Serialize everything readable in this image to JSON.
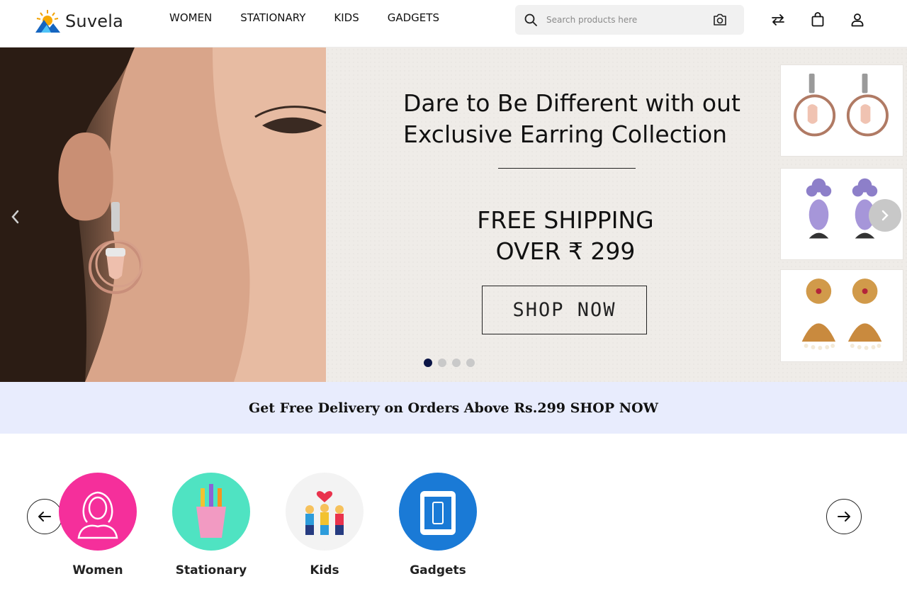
{
  "brand": {
    "name": "Suvela"
  },
  "nav": {
    "items": [
      "WOMEN",
      "STATIONARY",
      "KIDS",
      "GADGETS"
    ]
  },
  "search": {
    "placeholder": "Search products here"
  },
  "icons": {
    "search": "search-icon",
    "camera": "camera-icon",
    "compare": "compare-arrows-icon",
    "cart": "shopping-bag-icon",
    "account": "user-icon"
  },
  "hero": {
    "title_line1": "Dare to Be Different with out",
    "title_line2": "Exclusive Earring Collection",
    "shipping_line1": "FREE SHIPPING",
    "shipping_line2": "OVER ₹ 299",
    "cta": "SHOP NOW",
    "slides": 4,
    "active_slide": 1
  },
  "banner": {
    "text": "Get Free Delivery on Orders Above Rs.299 SHOP NOW"
  },
  "categories": [
    {
      "label": "Women",
      "color": "#f52f9b"
    },
    {
      "label": "Stationary",
      "color": "#4fe3c2"
    },
    {
      "label": "Kids",
      "color": "#f3f3f3"
    },
    {
      "label": "Gadgets",
      "color": "#1a7ad6"
    }
  ],
  "colors": {
    "accent_dark": "#0b1546",
    "banner_bg": "#e8ecfd"
  }
}
